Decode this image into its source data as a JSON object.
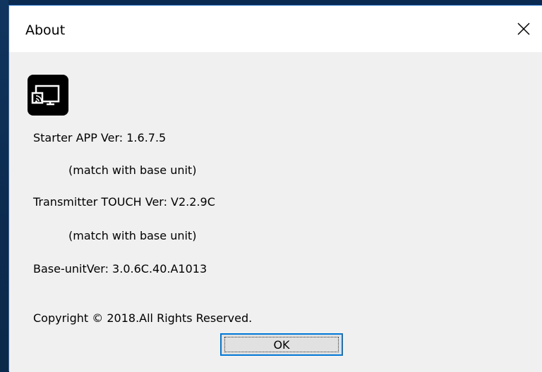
{
  "window": {
    "title": "About"
  },
  "icons": {
    "close": "close-icon",
    "app": "screen-cast-icon"
  },
  "content": {
    "starter_version": "Starter APP Ver: 1.6.7.5",
    "starter_match": "(match with base unit)",
    "transmitter_version": "Transmitter TOUCH Ver: V2.2.9C",
    "transmitter_match": "(match with base unit)",
    "base_unit_version": "Base-unitVer: 3.0.6C.40.A1013",
    "copyright": "Copyright © 2018.All Rights Reserved."
  },
  "buttons": {
    "ok_label": "OK"
  },
  "colors": {
    "accent": "#0078d7",
    "background": "#f0f0f0",
    "titlebar": "#ffffff"
  }
}
